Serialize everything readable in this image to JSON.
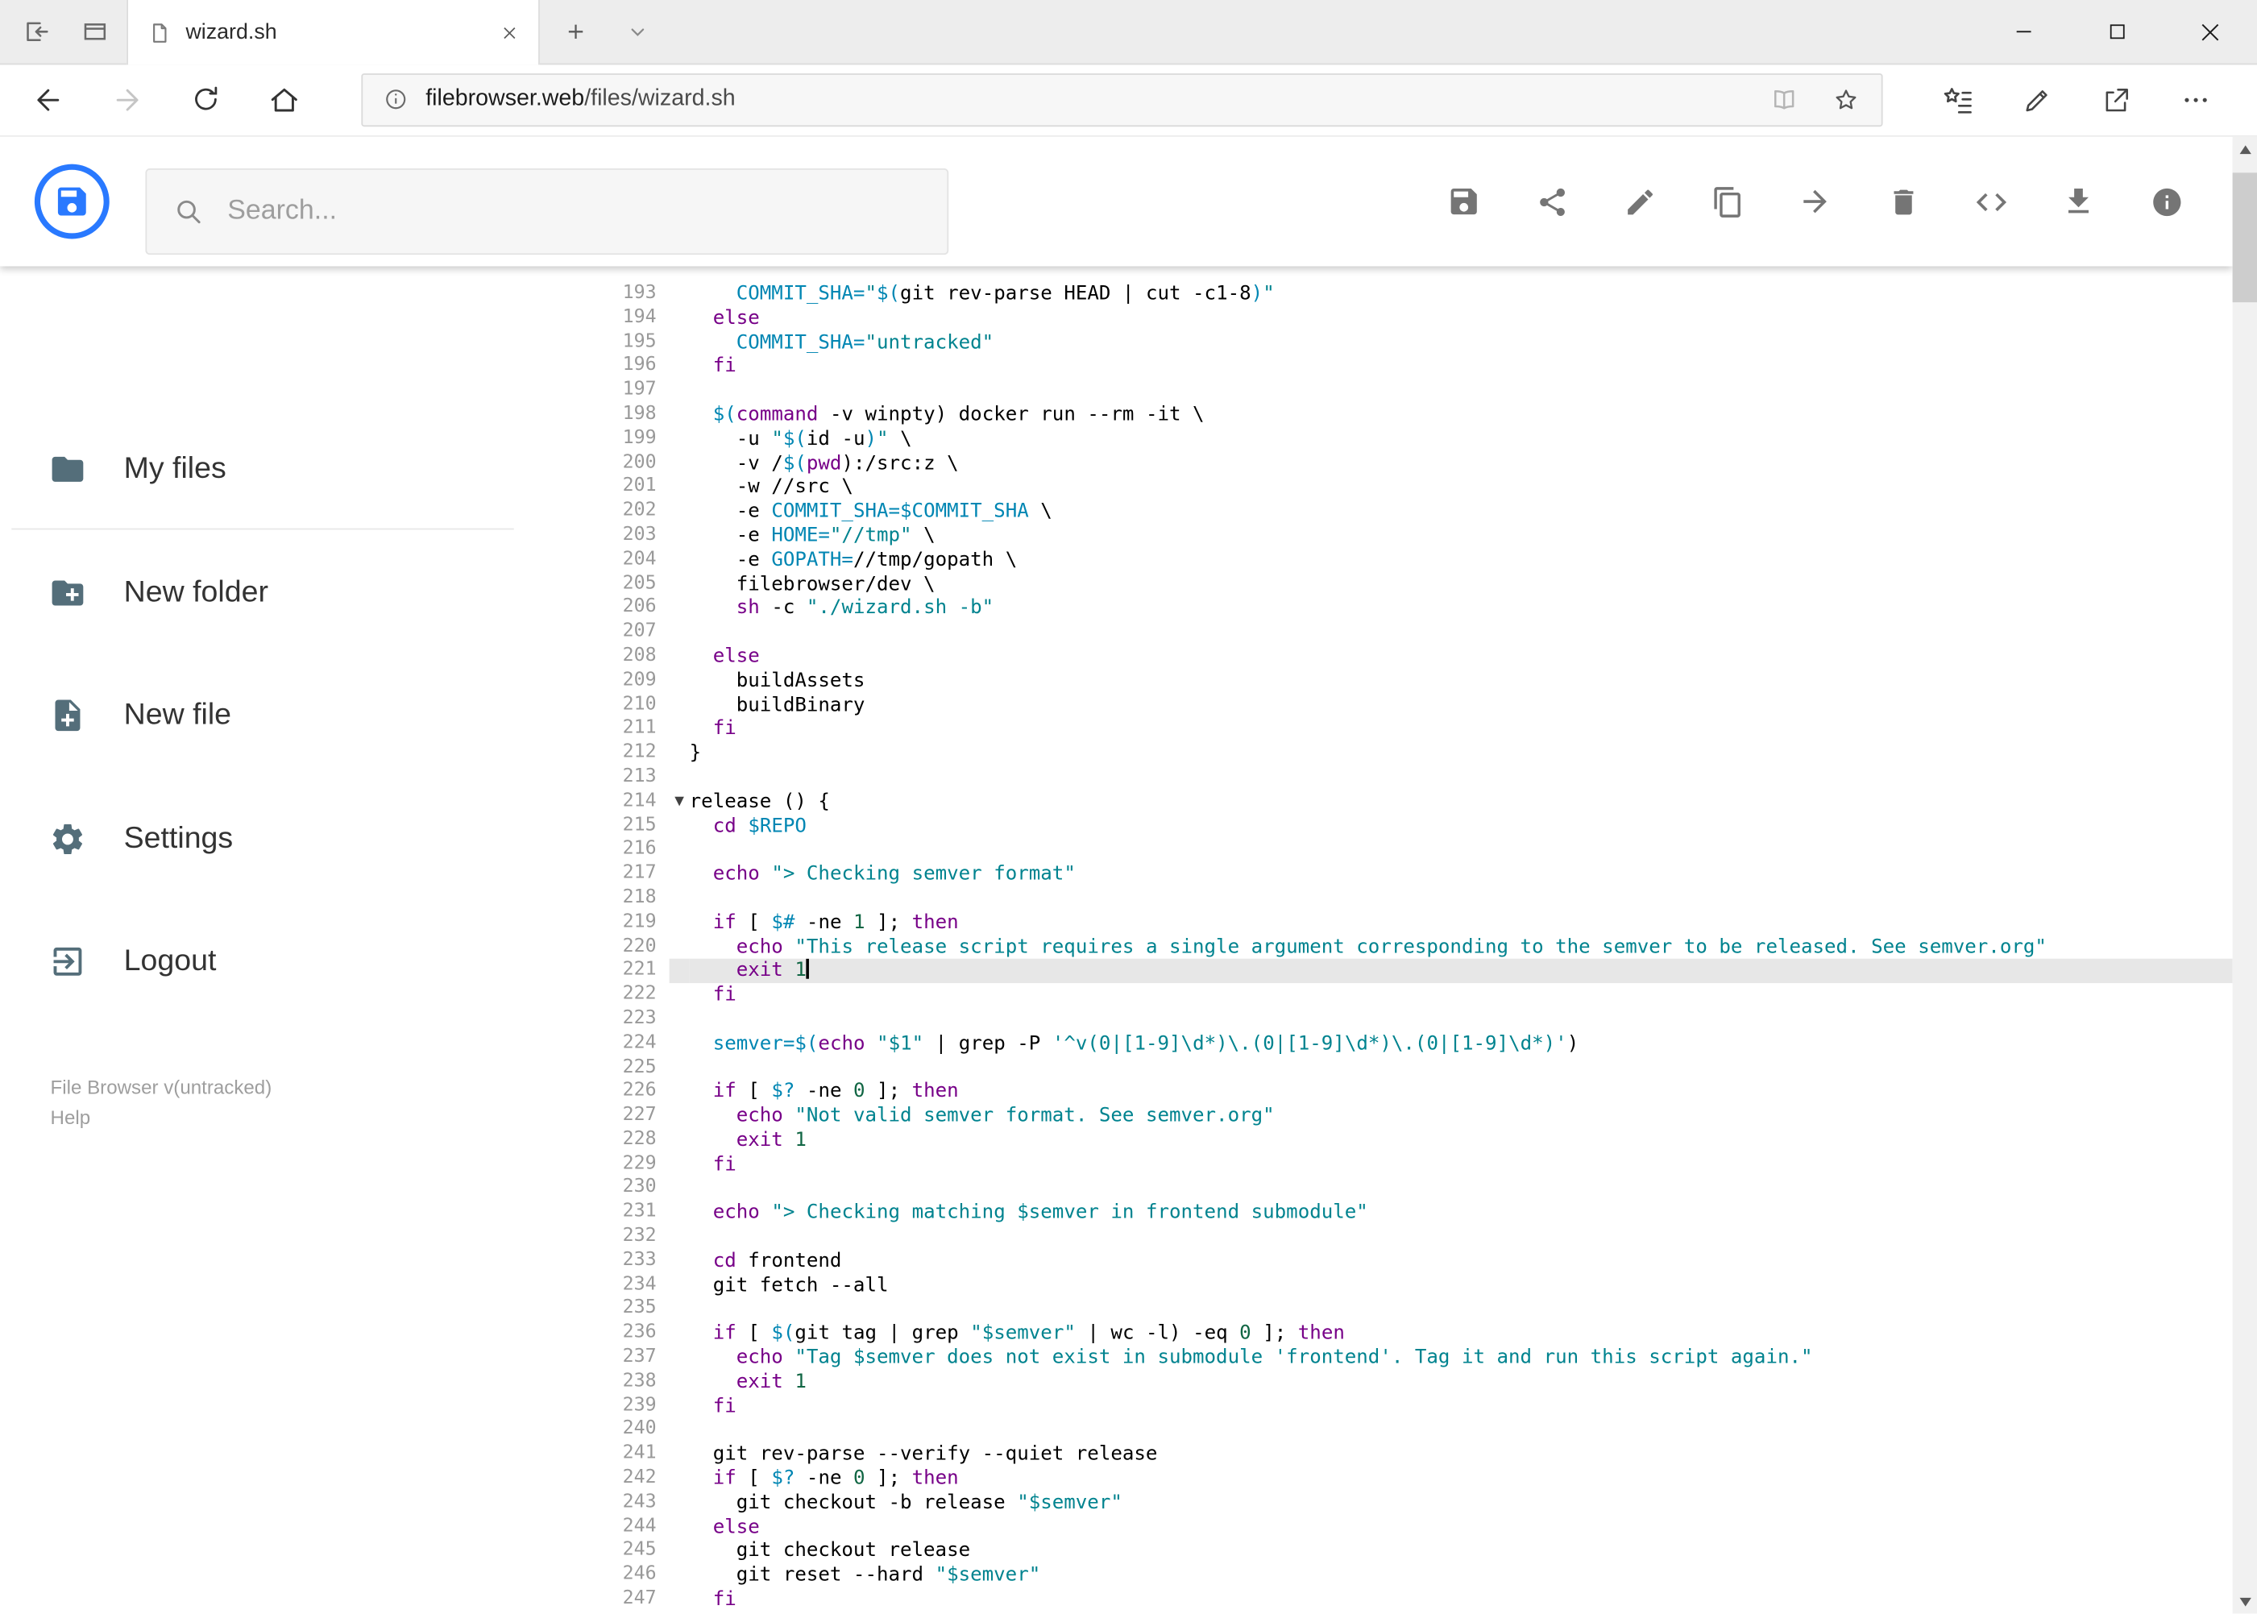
{
  "browser": {
    "window_controls": [
      "minimize",
      "maximize",
      "close"
    ],
    "titlebar_icons": [
      "set-tabs-aside",
      "tabs-you-set-aside"
    ],
    "tab": {
      "title": "wizard.sh",
      "favicon": "document-icon",
      "close_icon": "close-icon"
    },
    "new_tab_icon": "plus-icon",
    "tab_preview_icon": "chevron-down-icon",
    "nav_icons": [
      "back",
      "forward",
      "refresh",
      "home"
    ],
    "address": {
      "info_icon": "info-circle-icon",
      "domain": "filebrowser.web",
      "path": "/files/wizard.sh",
      "right_icons": [
        "reading-view",
        "favorite-star"
      ]
    },
    "action_icons": [
      "hub-favorites",
      "web-note-pen",
      "share",
      "more-options"
    ]
  },
  "header": {
    "logo": "file-browser-logo",
    "search": {
      "placeholder": "Search...",
      "icon": "search-icon"
    },
    "toolbar": [
      {
        "name": "save",
        "icon": "floppy-icon"
      },
      {
        "name": "share",
        "icon": "share-icon"
      },
      {
        "name": "rename",
        "icon": "pencil-icon"
      },
      {
        "name": "copy",
        "icon": "copy-icon"
      },
      {
        "name": "move",
        "icon": "arrow-forward-icon"
      },
      {
        "name": "delete",
        "icon": "trash-icon"
      },
      {
        "name": "raw",
        "icon": "code-icon"
      },
      {
        "name": "download",
        "icon": "download-icon"
      },
      {
        "name": "info",
        "icon": "info-icon"
      }
    ]
  },
  "sidebar": {
    "items": [
      {
        "label": "My files",
        "icon": "folder-icon"
      },
      {
        "label": "New folder",
        "icon": "new-folder-icon"
      },
      {
        "label": "New file",
        "icon": "new-file-icon"
      },
      {
        "label": "Settings",
        "icon": "settings-gear-icon"
      },
      {
        "label": "Logout",
        "icon": "logout-icon"
      }
    ],
    "footer": {
      "version": "File Browser v(untracked)",
      "help": "Help"
    }
  },
  "editor": {
    "language": "shell",
    "first_line": 193,
    "active_line": 221,
    "cursor_after_text": "exit 1",
    "fold_marker_lines": [
      214
    ],
    "lines": [
      "    COMMIT_SHA=\"$(git rev-parse HEAD | cut -c1-8)\"",
      "  else",
      "    COMMIT_SHA=\"untracked\"",
      "  fi",
      "",
      "  $(command -v winpty) docker run --rm -it \\",
      "    -u \"$(id -u)\" \\",
      "    -v /$(pwd):/src:z \\",
      "    -w //src \\",
      "    -e COMMIT_SHA=$COMMIT_SHA \\",
      "    -e HOME=\"//tmp\" \\",
      "    -e GOPATH=//tmp/gopath \\",
      "    filebrowser/dev \\",
      "    sh -c \"./wizard.sh -b\"",
      "",
      "  else",
      "    buildAssets",
      "    buildBinary",
      "  fi",
      "}",
      "",
      "release () {",
      "  cd $REPO",
      "",
      "  echo \"> Checking semver format\"",
      "",
      "  if [ $# -ne 1 ]; then",
      "    echo \"This release script requires a single argument corresponding to the semver to be released. See semver.org\"",
      "    exit 1",
      "  fi",
      "",
      "  semver=$(echo \"$1\" | grep -P '^v(0|[1-9]\\d*)\\.(0|[1-9]\\d*)\\.(0|[1-9]\\d*)')",
      "",
      "  if [ $? -ne 0 ]; then",
      "    echo \"Not valid semver format. See semver.org\"",
      "    exit 1",
      "  fi",
      "",
      "  echo \"> Checking matching $semver in frontend submodule\"",
      "",
      "  cd frontend",
      "  git fetch --all",
      "",
      "  if [ $(git tag | grep \"$semver\" | wc -l) -eq 0 ]; then",
      "    echo \"Tag $semver does not exist in submodule 'frontend'. Tag it and run this script again.\"",
      "    exit 1",
      "  fi",
      "",
      "  git rev-parse --verify --quiet release",
      "  if [ $? -ne 0 ]; then",
      "    git checkout -b release \"$semver\"",
      "  else",
      "    git checkout release",
      "    git reset --hard \"$semver\"",
      "  fi"
    ]
  },
  "colors": {
    "accent_blue": "#2979ff",
    "toolbar_icon_gray": "#757575",
    "sidebar_icon_gray": "#546e7a",
    "syntax_keyword": "#770088",
    "syntax_string": "#00838f",
    "syntax_variable": "#0086b3",
    "syntax_number": "#116644",
    "line_number_gray": "#999999",
    "active_line_bg": "#e7e7e7"
  }
}
